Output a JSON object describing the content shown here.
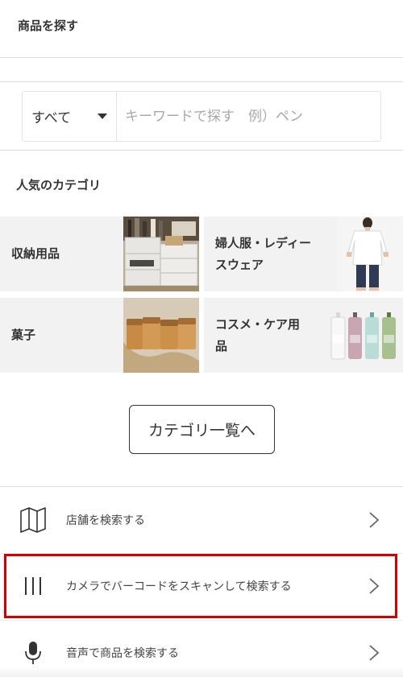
{
  "header": {
    "find_title": "商品を探す"
  },
  "search": {
    "scope_selected": "すべて",
    "placeholder": "キーワードで探す　例）ペン"
  },
  "categories": {
    "title": "人気のカテゴリ",
    "tiles": [
      {
        "label": "収納用品"
      },
      {
        "label": "婦人服・レディー\nスウェア"
      },
      {
        "label": "菓子"
      },
      {
        "label": "コスメ・ケア用\n品"
      }
    ],
    "all_button": "カテゴリ一覧へ"
  },
  "menu": [
    {
      "label": "店舗を検索する",
      "icon": "map-icon"
    },
    {
      "label": "カメラでバーコードをスキャンして検索する",
      "icon": "barcode-icon"
    },
    {
      "label": "音声で商品を検索する",
      "icon": "microphone-icon"
    }
  ],
  "colors": {
    "highlight": "#d60000",
    "tile_bg": "#f2f2f2"
  }
}
